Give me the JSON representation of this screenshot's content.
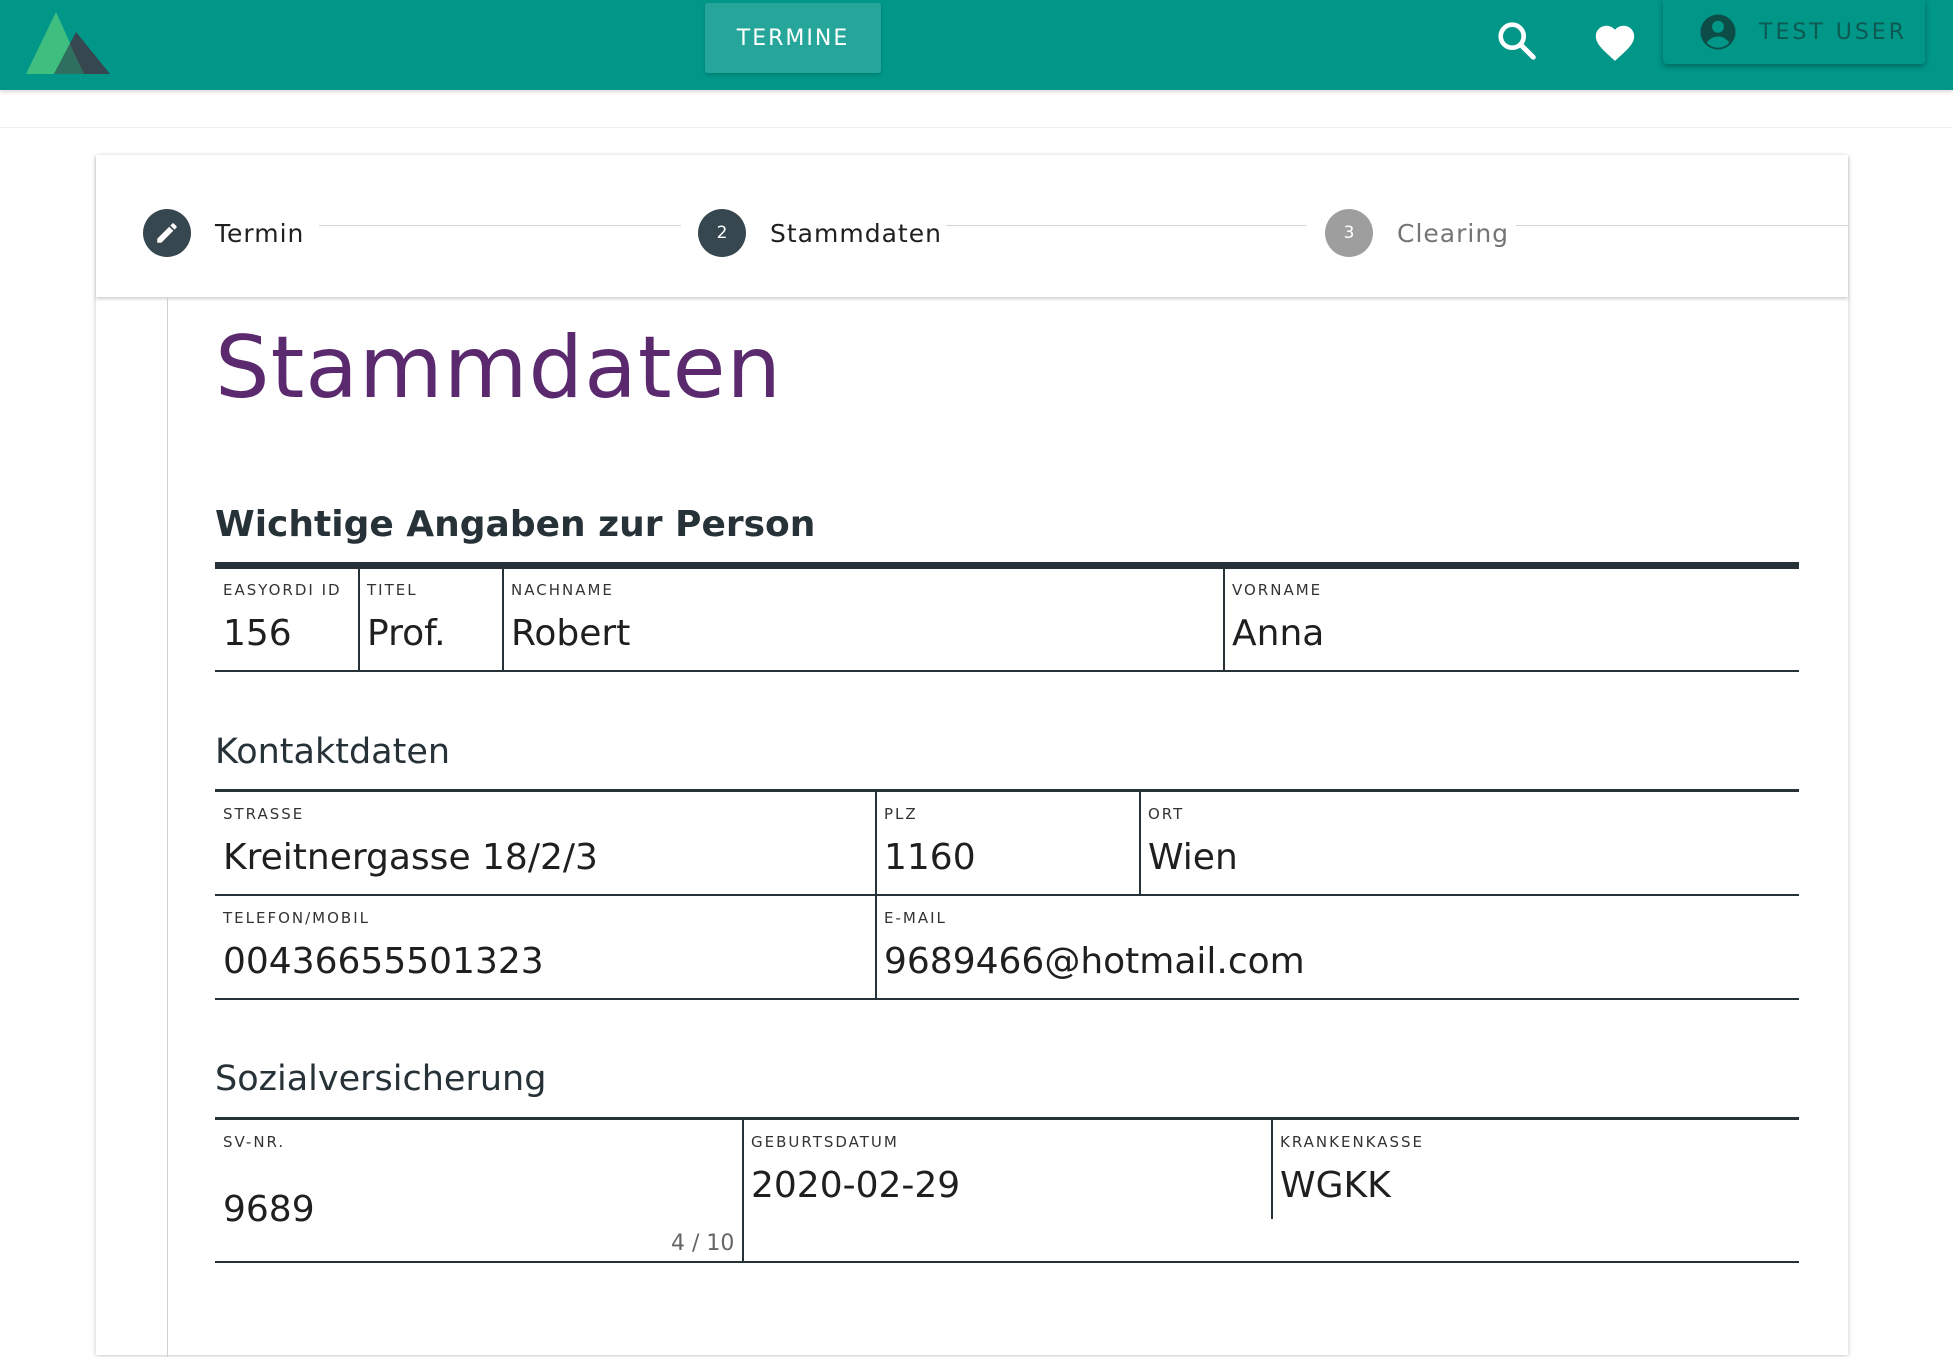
{
  "topbar": {
    "nav_button": "TERMINE",
    "user_label": "TEST USER"
  },
  "stepper": {
    "steps": [
      {
        "number": "",
        "label": "Termin",
        "state": "edit"
      },
      {
        "number": "2",
        "label": "Stammdaten",
        "state": "active"
      },
      {
        "number": "3",
        "label": "Clearing",
        "state": "inactive"
      }
    ]
  },
  "page": {
    "title": "Stammdaten"
  },
  "person": {
    "heading": "Wichtige Angaben zur Person",
    "fields": [
      {
        "label": "EASYORDI ID",
        "value": "156"
      },
      {
        "label": "TITEL",
        "value": "Prof."
      },
      {
        "label": "NACHNAME",
        "value": "Robert"
      },
      {
        "label": "VORNAME",
        "value": "Anna"
      }
    ]
  },
  "contact": {
    "heading": "Kontaktdaten",
    "fields": [
      {
        "label": "STRASSE",
        "value": "Kreitnergasse 18/2/3"
      },
      {
        "label": "PLZ",
        "value": "1160"
      },
      {
        "label": "ORT",
        "value": "Wien"
      },
      {
        "label": "TELEFON/MOBIL",
        "value": "00436655501323"
      },
      {
        "label": "E-MAIL",
        "value": "9689466@hotmail.com"
      }
    ]
  },
  "insurance": {
    "heading": "Sozialversicherung",
    "fields": [
      {
        "label": "SV-NR.",
        "value": "9689",
        "counter": "4 / 10"
      },
      {
        "label": "GEBURTSDATUM",
        "value": "2020-02-29"
      },
      {
        "label": "KRANKENKASSE",
        "value": "WGKK"
      }
    ]
  },
  "colors": {
    "primary": "#009688",
    "title": "#5b2a6e",
    "dark": "#263238"
  },
  "icons": [
    "app-logo-icon",
    "search-icon",
    "heart-icon",
    "account-circle-icon",
    "pencil-icon"
  ]
}
